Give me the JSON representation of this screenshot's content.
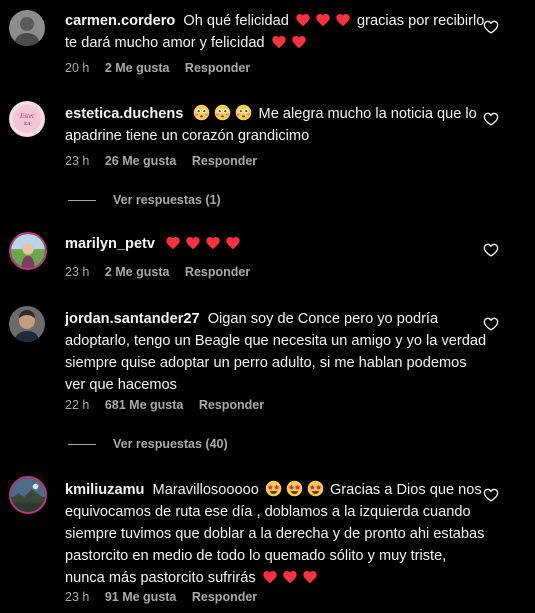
{
  "comments": [
    {
      "username": "carmen.cordero",
      "segments": [
        "Oh qué felicidad",
        "gracias por recibirlo te dará mucho amor y felicidad"
      ],
      "time": "20 h",
      "likes": "2 Me gusta",
      "reply": "Responder"
    },
    {
      "username": "estetica.duchens",
      "segments": [
        "Me alegra mucho la noticia que lo apadrine tiene un corazón grandicimo"
      ],
      "time": "23 h",
      "likes": "26 Me gusta",
      "reply": "Responder",
      "view_replies": "Ver respuestas (1)"
    },
    {
      "username": "marilyn_petv",
      "segments": [],
      "time": "23 h",
      "likes": "2 Me gusta",
      "reply": "Responder"
    },
    {
      "username": "jordan.santander27",
      "segments": [
        "Oigan soy de Conce pero yo podría adoptarlo, tengo un Beagle que necesita un amigo y yo la verdad siempre quise adoptar un perro adulto, si me hablan podemos ver que hacemos"
      ],
      "time": "22 h",
      "likes": "681 Me gusta",
      "reply": "Responder",
      "view_replies": "Ver respuestas (40)"
    },
    {
      "username": "kmiliuzamu",
      "segments": [
        "Maravillosooooo",
        "Gracias a Dios que nos equivocamos de ruta ese día , doblamos a la izquierda cuando siempre tuvimos que doblar a la derecha y de pronto ahi estabas pastorcito en medio de todo lo quemado sólito y muy triste, nunca más pastorcito sufrirás"
      ],
      "time": "23 h",
      "likes": "91 Me gusta",
      "reply": "Responder"
    }
  ],
  "icons": {
    "heart": "heart-outline-icon",
    "emoji_heart": "red-heart-emoji",
    "emoji_flushed": "flushed-face-emoji",
    "emoji_starstruck": "star-struck-emoji"
  },
  "colors": {
    "background": "#000000",
    "text": "#f5f5f5",
    "muted": "#a8a8a8",
    "heart": "#ff3040"
  }
}
